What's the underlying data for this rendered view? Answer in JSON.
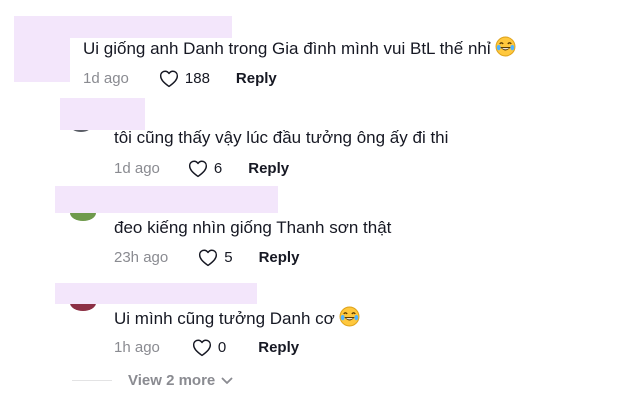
{
  "comments": [
    {
      "text": "Ui giống anh Danh trong Gia đình mình vui BtL thế nhỉ",
      "has_emoji": true,
      "time": "1d ago",
      "likes": "188",
      "reply_label": "Reply"
    },
    {
      "text": "tôi cũng thấy vậy lúc đầu tưởng ông ấy đi thi",
      "has_emoji": false,
      "time": "1d ago",
      "likes": "6",
      "reply_label": "Reply"
    },
    {
      "text": "đeo kiếng nhìn giống Thanh sơn thật",
      "has_emoji": false,
      "time": "23h ago",
      "likes": "5",
      "reply_label": "Reply"
    },
    {
      "text": "Ui mình cũng tưởng Danh cơ",
      "has_emoji": true,
      "time": "1h ago",
      "likes": "0",
      "reply_label": "Reply"
    }
  ],
  "view_more": {
    "label": "View 2 more"
  },
  "colors": {
    "text": "#161823",
    "muted": "#8a8b91",
    "redaction": "#f3e6fb"
  },
  "icons": {
    "like": "heart-outline-icon",
    "emoji": "laughing-tears-emoji-icon",
    "expand": "chevron-down-icon"
  }
}
